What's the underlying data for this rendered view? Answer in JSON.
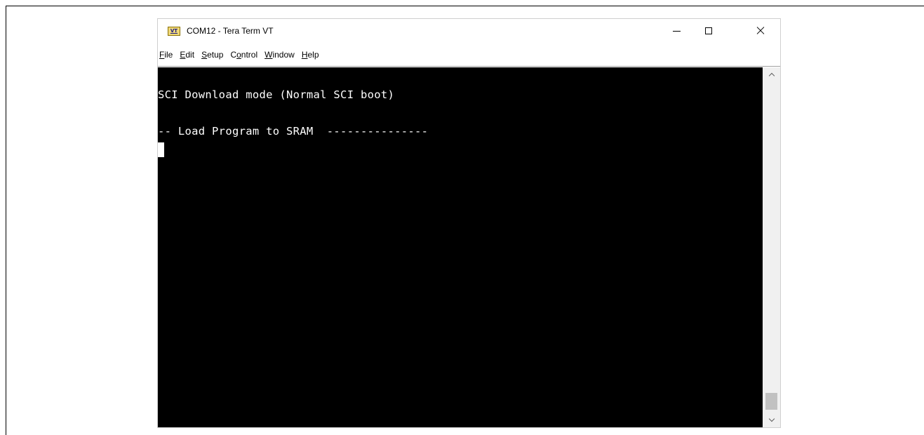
{
  "window": {
    "icon_label": "VT",
    "title": "COM12 - Tera Term VT"
  },
  "menu": [
    {
      "pre": "",
      "key": "F",
      "post": "ile"
    },
    {
      "pre": "",
      "key": "E",
      "post": "dit"
    },
    {
      "pre": "",
      "key": "S",
      "post": "etup"
    },
    {
      "pre": "C",
      "key": "o",
      "post": "ntrol"
    },
    {
      "pre": "",
      "key": "W",
      "post": "indow"
    },
    {
      "pre": "",
      "key": "H",
      "post": "elp"
    }
  ],
  "terminal": {
    "lines": [
      "SCI Download mode (Normal SCI boot)",
      "-- Load Program to SRAM  ---------------"
    ]
  },
  "colors": {
    "terminal_bg": "#000000",
    "terminal_fg": "#ffffff"
  }
}
